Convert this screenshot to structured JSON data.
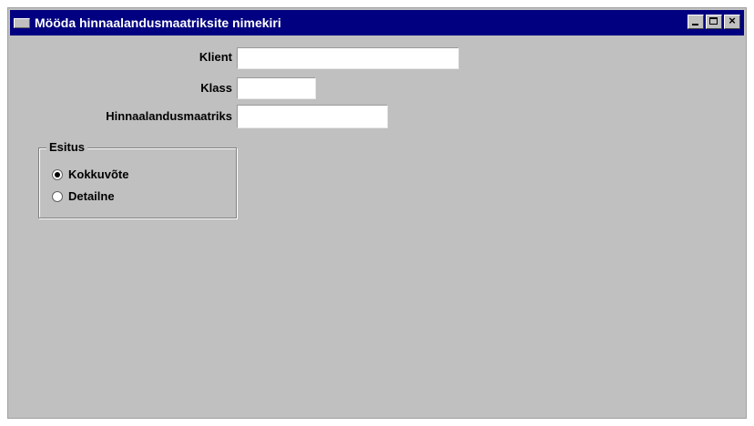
{
  "window": {
    "title": "Mööda hinnaalandusmaatriksite nimekiri",
    "controls": {
      "minimize_icon": "minimize-icon",
      "maximize_icon": "maximize-icon",
      "close_icon": "close-icon",
      "close_glyph": "×"
    }
  },
  "form": {
    "klient_label": "Klient",
    "klient_value": "",
    "klass_label": "Klass",
    "klass_value": "",
    "matrix_label": "Hinnaalandusmaatriks",
    "matrix_value": ""
  },
  "group": {
    "title": "Esitus",
    "options": [
      {
        "label": "Kokkuvõte",
        "selected": true
      },
      {
        "label": "Detailne",
        "selected": false
      }
    ]
  },
  "colors": {
    "titlebar": "#000080",
    "window_bg": "#c0c0c0",
    "field_bg": "#ffffff"
  }
}
